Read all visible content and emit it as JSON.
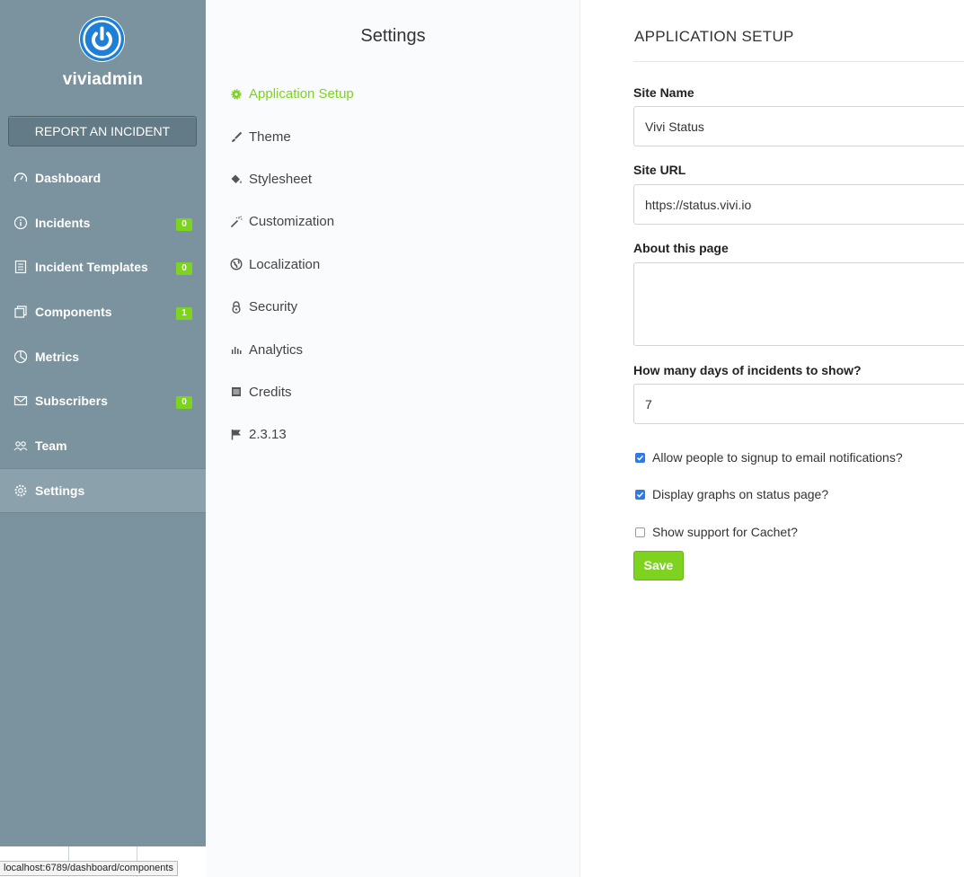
{
  "colors": {
    "sidebar_bg": "#7a939f",
    "accent_green": "#7ed321",
    "logo_blue": "#1e7fd6",
    "checkbox_blue": "#2d7be6"
  },
  "sidebar": {
    "logo_icon": "power-icon",
    "brand_name": "viviadmin",
    "report_button": "REPORT AN INCIDENT",
    "items": [
      {
        "label": "Dashboard",
        "icon": "dashboard-gauge-icon",
        "badge": null,
        "active": false
      },
      {
        "label": "Incidents",
        "icon": "info-circle-icon",
        "badge": "0",
        "active": false
      },
      {
        "label": "Incident Templates",
        "icon": "document-icon",
        "badge": "0",
        "active": false
      },
      {
        "label": "Components",
        "icon": "copy-icon",
        "badge": "1",
        "active": false
      },
      {
        "label": "Metrics",
        "icon": "pie-chart-icon",
        "badge": null,
        "active": false
      },
      {
        "label": "Subscribers",
        "icon": "mail-icon",
        "badge": "0",
        "active": false
      },
      {
        "label": "Team",
        "icon": "team-icon",
        "badge": null,
        "active": false
      },
      {
        "label": "Settings",
        "icon": "gear-icon",
        "badge": null,
        "active": true
      }
    ],
    "status_url": "localhost:6789/dashboard/components"
  },
  "settings_nav": {
    "title": "Settings",
    "items": [
      {
        "label": "Application Setup",
        "icon": "cog-icon",
        "active": true
      },
      {
        "label": "Theme",
        "icon": "brush-icon",
        "active": false
      },
      {
        "label": "Stylesheet",
        "icon": "paint-bucket-icon",
        "active": false
      },
      {
        "label": "Customization",
        "icon": "magic-wand-icon",
        "active": false
      },
      {
        "label": "Localization",
        "icon": "globe-icon",
        "active": false
      },
      {
        "label": "Security",
        "icon": "lock-icon",
        "active": false
      },
      {
        "label": "Analytics",
        "icon": "bar-chart-icon",
        "active": false
      },
      {
        "label": "Credits",
        "icon": "list-icon",
        "active": false
      },
      {
        "label": "2.3.13",
        "icon": "flag-icon",
        "active": false
      }
    ]
  },
  "form": {
    "title": "APPLICATION SETUP",
    "site_name": {
      "label": "Site Name",
      "value": "Vivi Status"
    },
    "site_url": {
      "label": "Site URL",
      "value": "https://status.vivi.io"
    },
    "about": {
      "label": "About this page",
      "value": ""
    },
    "days": {
      "label": "How many days of incidents to show?",
      "value": "7"
    },
    "checkboxes": [
      {
        "label": "Allow people to signup to email notifications?",
        "checked": true
      },
      {
        "label": "Display graphs on status page?",
        "checked": true
      },
      {
        "label": "Show support for Cachet?",
        "checked": false
      }
    ],
    "save_label": "Save"
  }
}
